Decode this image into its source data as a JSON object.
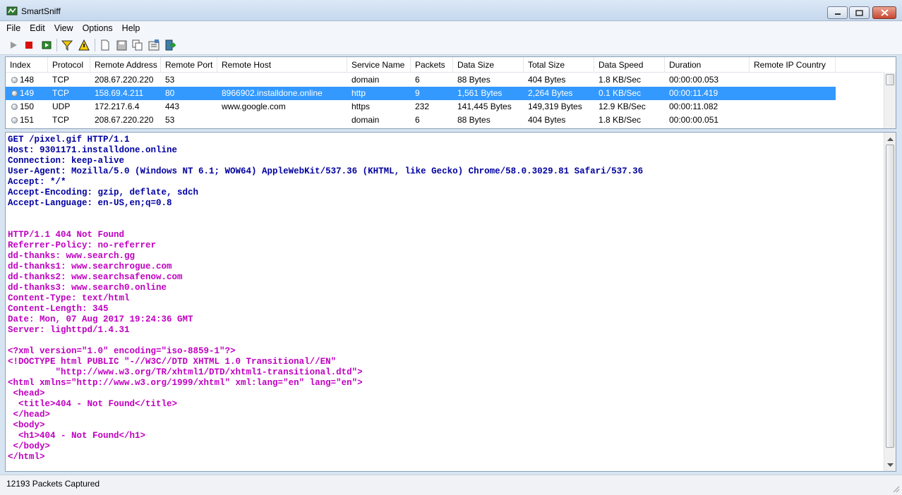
{
  "window": {
    "title": "SmartSniff"
  },
  "menu": [
    "File",
    "Edit",
    "View",
    "Options",
    "Help"
  ],
  "toolbar": {
    "buttons": [
      "play-icon",
      "stop-icon",
      "start-capture-icon",
      "filter-icon",
      "warning-icon",
      "new-file-icon",
      "save-icon",
      "copy-icon",
      "properties-icon",
      "exit-icon"
    ]
  },
  "table": {
    "columns": [
      "Index",
      "Protocol",
      "Remote Address",
      "Remote Port",
      "Remote Host",
      "Service Name",
      "Packets",
      "Data Size",
      "Total Size",
      "Data Speed",
      "Duration",
      "Remote IP Country"
    ],
    "rows": [
      {
        "index": "148",
        "protocol": "TCP",
        "remote_address": "208.67.220.220",
        "remote_port": "53",
        "remote_host": "",
        "service": "domain",
        "packets": "6",
        "data_size": "88 Bytes",
        "total_size": "404 Bytes",
        "speed": "1.8 KB/Sec",
        "duration": "00:00:00.053",
        "country": ""
      },
      {
        "index": "149",
        "protocol": "TCP",
        "remote_address": "158.69.4.211",
        "remote_port": "80",
        "remote_host": "8966902.installdone.online",
        "service": "http",
        "packets": "9",
        "data_size": "1,561 Bytes",
        "total_size": "2,264 Bytes",
        "speed": "0.1 KB/Sec",
        "duration": "00:00:11.419",
        "country": ""
      },
      {
        "index": "150",
        "protocol": "UDP",
        "remote_address": "172.217.6.4",
        "remote_port": "443",
        "remote_host": "www.google.com",
        "service": "https",
        "packets": "232",
        "data_size": "141,445 Bytes",
        "total_size": "149,319 Bytes",
        "speed": "12.9 KB/Sec",
        "duration": "00:00:11.082",
        "country": ""
      },
      {
        "index": "151",
        "protocol": "TCP",
        "remote_address": "208.67.220.220",
        "remote_port": "53",
        "remote_host": "",
        "service": "domain",
        "packets": "6",
        "data_size": "88 Bytes",
        "total_size": "404 Bytes",
        "speed": "1.8 KB/Sec",
        "duration": "00:00:00.051",
        "country": ""
      }
    ],
    "selected_index": "149"
  },
  "content": {
    "request_lines": [
      "GET /pixel.gif HTTP/1.1",
      "Host: 9301171.installdone.online",
      "Connection: keep-alive",
      "User-Agent: Mozilla/5.0 (Windows NT 6.1; WOW64) AppleWebKit/537.36 (KHTML, like Gecko) Chrome/58.0.3029.81 Safari/537.36",
      "Accept: */*",
      "Accept-Encoding: gzip, deflate, sdch",
      "Accept-Language: en-US,en;q=0.8"
    ],
    "response_lines": [
      "HTTP/1.1 404 Not Found",
      "Referrer-Policy: no-referrer",
      "dd-thanks: www.search.gg",
      "dd-thanks1: www.searchrogue.com",
      "dd-thanks2: www.searchsafenow.com",
      "dd-thanks3: www.search0.online",
      "Content-Type: text/html",
      "Content-Length: 345",
      "Date: Mon, 07 Aug 2017 19:24:36 GMT",
      "Server: lighttpd/1.4.31",
      "",
      "<?xml version=\"1.0\" encoding=\"iso-8859-1\"?>",
      "<!DOCTYPE html PUBLIC \"-//W3C//DTD XHTML 1.0 Transitional//EN\"",
      "         \"http://www.w3.org/TR/xhtml1/DTD/xhtml1-transitional.dtd\">",
      "<html xmlns=\"http://www.w3.org/1999/xhtml\" xml:lang=\"en\" lang=\"en\">",
      " <head>",
      "  <title>404 - Not Found</title>",
      " </head>",
      " <body>",
      "  <h1>404 - Not Found</h1>",
      " </body>",
      "</html>"
    ]
  },
  "status": {
    "text": "12193 Packets Captured"
  },
  "colors": {
    "request_text": "#0000a0",
    "response_text": "#c000c0",
    "selection": "#3399ff"
  }
}
